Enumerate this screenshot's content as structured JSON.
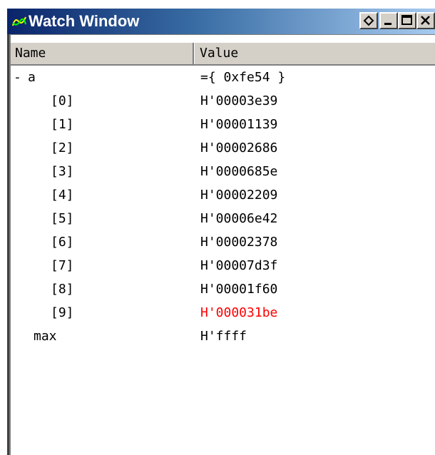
{
  "window": {
    "title": "Watch Window",
    "controls": [
      "options",
      "minimize",
      "maximize",
      "close"
    ]
  },
  "columns": {
    "name": "Name",
    "value": "Value"
  },
  "tree": {
    "expand_glyph": "-",
    "root": {
      "name": "a",
      "value": "={ 0xfe54 }"
    },
    "elements": [
      {
        "name": "[0]",
        "value": "H'00003e39",
        "changed": false
      },
      {
        "name": "[1]",
        "value": "H'00001139",
        "changed": false
      },
      {
        "name": "[2]",
        "value": "H'00002686",
        "changed": false
      },
      {
        "name": "[3]",
        "value": "H'0000685e",
        "changed": false
      },
      {
        "name": "[4]",
        "value": "H'00002209",
        "changed": false
      },
      {
        "name": "[5]",
        "value": "H'00006e42",
        "changed": false
      },
      {
        "name": "[6]",
        "value": "H'00002378",
        "changed": false
      },
      {
        "name": "[7]",
        "value": "H'00007d3f",
        "changed": false
      },
      {
        "name": "[8]",
        "value": "H'00001f60",
        "changed": false
      },
      {
        "name": "[9]",
        "value": "H'000031be",
        "changed": true
      }
    ],
    "max": {
      "name": "max",
      "value": "H'ffff"
    }
  },
  "colors": {
    "changed_value": "#ff0000",
    "title_gradient_start": "#0a246a",
    "title_gradient_end": "#a6caf0"
  }
}
